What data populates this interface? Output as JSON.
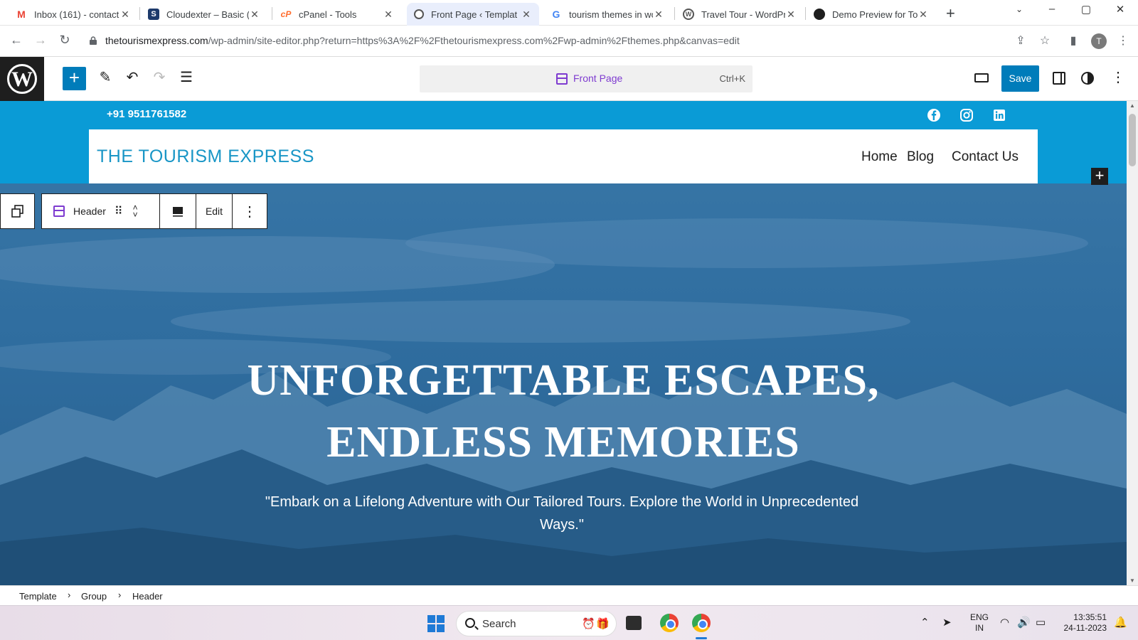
{
  "browser": {
    "tabs": [
      {
        "title": "Inbox (161) - contact",
        "favicon": "gmail-icon",
        "active": false
      },
      {
        "title": "Cloudexter – Basic (th",
        "favicon": "cloudexter-icon",
        "active": false
      },
      {
        "title": "cPanel - Tools",
        "favicon": "cpanel-icon",
        "active": false
      },
      {
        "title": "Front Page ‹ Templat",
        "favicon": "globe-icon",
        "active": true
      },
      {
        "title": "tourism themes in wo",
        "favicon": "google-icon",
        "active": false
      },
      {
        "title": "Travel Tour - WordPr",
        "favicon": "wordpress-icon",
        "active": false
      },
      {
        "title": "Demo Preview for To",
        "favicon": "demo-icon",
        "active": false
      }
    ],
    "url_host": "thetourismexpress.com",
    "url_path": "/wp-admin/site-editor.php?return=https%3A%2F%2Fthetourismexpress.com%2Fwp-admin%2Fthemes.php&canvas=edit",
    "profile_initial": "T"
  },
  "editor": {
    "command_label": "Front Page",
    "command_shortcut": "Ctrl+K",
    "save_label": "Save",
    "accent": "#007cba",
    "template_color": "#7e3bd0"
  },
  "block_toolbar": {
    "block_name": "Header",
    "edit_label": "Edit"
  },
  "site": {
    "phone": "+91 9511761582",
    "title": "THE TOURISM EXPRESS",
    "nav": [
      "Home",
      "Blog",
      "Contact Us"
    ],
    "social": [
      "facebook-icon",
      "instagram-icon",
      "linkedin-icon"
    ],
    "brand_color": "#0a9bd6",
    "headline_line1": "UNFORGETTABLE ESCAPES,",
    "headline_line2": "ENDLESS MEMORIES",
    "tagline": "\"Embark on a Lifelong Adventure with Our Tailored Tours. Explore the World in Unprecedented Ways.\""
  },
  "breadcrumb": [
    "Template",
    "Group",
    "Header"
  ],
  "taskbar": {
    "search_label": "Search",
    "lang_line1": "ENG",
    "lang_line2": "IN",
    "time": "13:35:51",
    "date": "24-11-2023"
  }
}
